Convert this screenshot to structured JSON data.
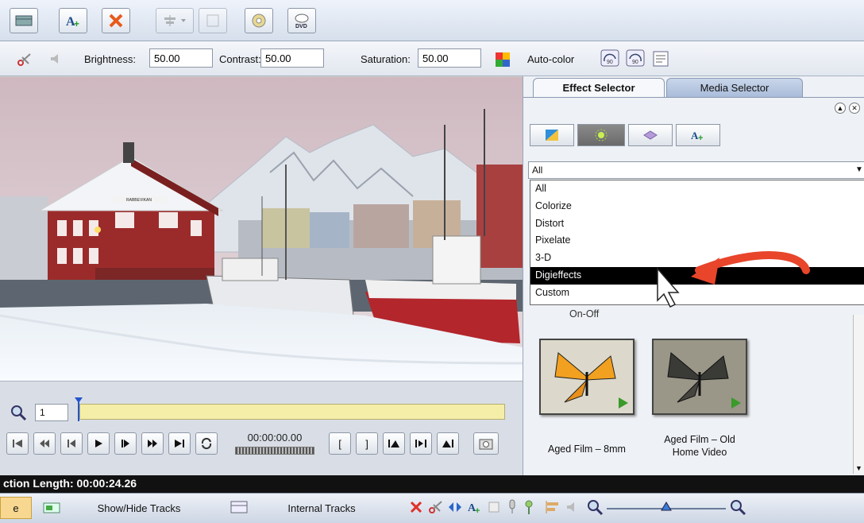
{
  "toolbar": {
    "buttons": [
      {
        "icon": "storyboard-icon"
      },
      {
        "icon": "add-text-icon"
      },
      {
        "icon": "delete-icon"
      },
      {
        "icon": "align-icon"
      },
      {
        "icon": "check-icon"
      },
      {
        "icon": "burn-disc-icon"
      },
      {
        "icon": "dvd-icon",
        "label": "DVD"
      }
    ]
  },
  "adjust": {
    "brightness_label": "Brightness:",
    "brightness_value": "50.00",
    "contrast_label": "Contrast:",
    "contrast_value": "50.00",
    "saturation_label": "Saturation:",
    "saturation_value": "50.00",
    "autocolor_label": "Auto-color"
  },
  "preview": {
    "building_sign": "RABBEVIKAN"
  },
  "transport": {
    "zoom_value": "1",
    "timecode": "00:00:00.00",
    "bracket_open": "[",
    "bracket_close": "]"
  },
  "panel": {
    "tabs": [
      "Effect Selector",
      "Media Selector"
    ],
    "filter_value": "All",
    "dropdown_options": [
      "All",
      "Colorize",
      "Distort",
      "Pixelate",
      "3-D",
      "Digieffects",
      "Custom"
    ],
    "selected_option": "Digieffects",
    "partial_label": "On-Off",
    "thumbnails": [
      {
        "label_line1": "Aged Film – 8mm",
        "label_line2": ""
      },
      {
        "label_line1": "Aged Film – Old",
        "label_line2": "Home Video"
      }
    ]
  },
  "status": {
    "text": "ction Length: 00:00:24.26"
  },
  "tracks": {
    "partial_tab": "e",
    "show_hide_label": "Show/Hide Tracks",
    "internal_label": "Internal Tracks"
  },
  "colors": {
    "accent_arrow": "#e8452b",
    "scrub_bar": "#f5eea8",
    "selection": "#000000"
  }
}
